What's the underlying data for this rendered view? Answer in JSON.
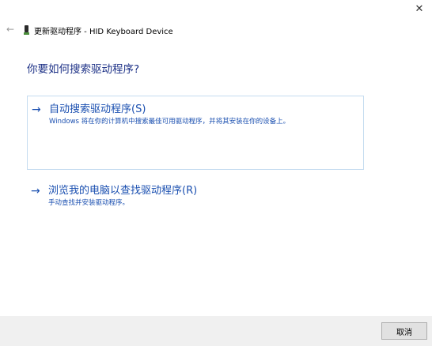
{
  "window": {
    "close_glyph": "✕",
    "back_glyph": "←",
    "title": "更新驱动程序 - HID Keyboard Device"
  },
  "main": {
    "heading": "你要如何搜索驱动程序?",
    "options": [
      {
        "arrow": "→",
        "title": "自动搜索驱动程序(S)",
        "description": "Windows 将在你的计算机中搜索最佳可用驱动程序，并将其安装在你的设备上。"
      },
      {
        "arrow": "→",
        "title": "浏览我的电脑以查找驱动程序(R)",
        "description": "手动查找并安装驱动程序。"
      }
    ]
  },
  "footer": {
    "cancel_label": "取消"
  },
  "colors": {
    "accent": "#1a4fb0",
    "heading": "#1e3287",
    "option_border": "#c5dcf0",
    "footer_bg": "#f0f0f0"
  },
  "icons": {
    "close": "close-icon",
    "back": "back-arrow-icon",
    "device": "keyboard-device-icon",
    "option_arrow": "arrow-right-icon"
  }
}
